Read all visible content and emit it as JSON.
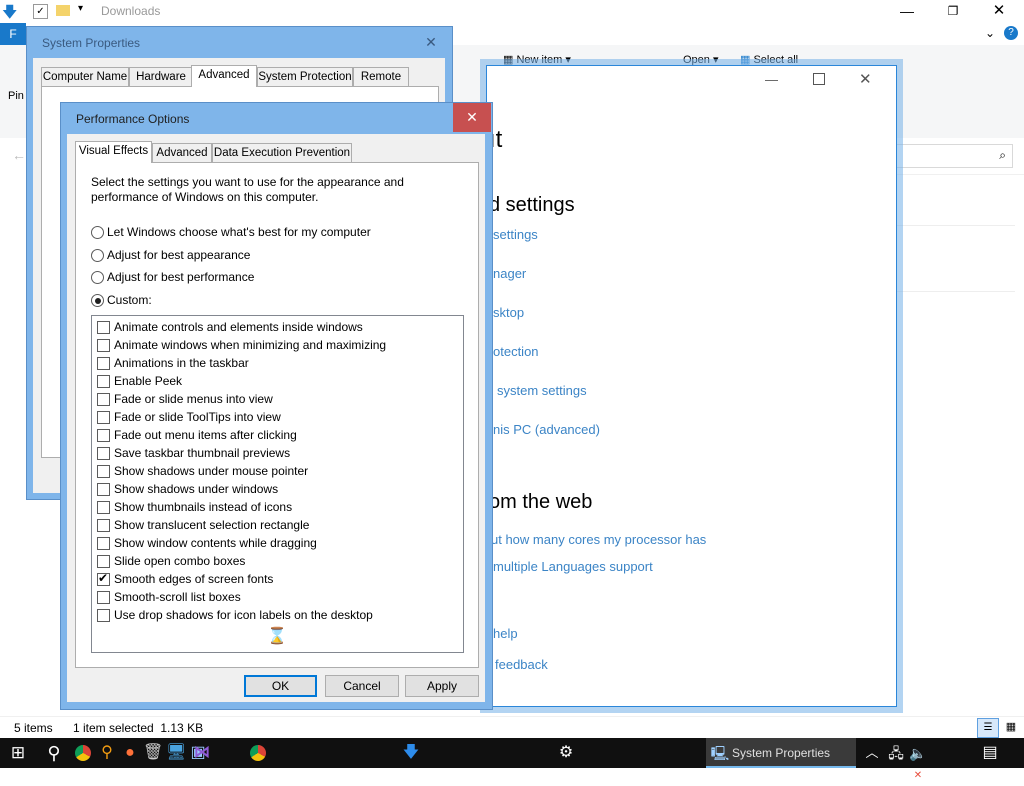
{
  "explorer": {
    "title": "Downloads",
    "file_tab": "F",
    "ribbon_new_item": "New item",
    "ribbon_open": "Open",
    "ribbon_select_all": "Select all",
    "pin_label": "Pin",
    "status_items": "5 items",
    "status_selected": "1 item selected  1.13 KB"
  },
  "about": {
    "heading_partial": "ıt",
    "related_heading": "d settings",
    "links": [
      "settings",
      "nager",
      "sktop",
      "otection",
      "system settings",
      "nis PC (advanced)"
    ],
    "web_heading": "om the web",
    "web_links": [
      "ut how many cores my processor has",
      "multiple Languages support"
    ],
    "help_link": "help",
    "feedback_link": "feedback"
  },
  "system_properties": {
    "title": "System Properties",
    "tabs": [
      "Computer Name",
      "Hardware",
      "Advanced",
      "System Protection",
      "Remote"
    ]
  },
  "performance_options": {
    "title": "Performance Options",
    "tabs": [
      "Visual Effects",
      "Advanced",
      "Data Execution Prevention"
    ],
    "description": "Select the settings you want to use for the appearance and performance of Windows on this computer.",
    "radios": [
      {
        "label": "Let Windows choose what's best for my computer",
        "selected": false
      },
      {
        "label": "Adjust for best appearance",
        "selected": false
      },
      {
        "label": "Adjust for best performance",
        "selected": false
      },
      {
        "label": "Custom:",
        "selected": true
      }
    ],
    "options": [
      {
        "label": "Animate controls and elements inside windows",
        "checked": false
      },
      {
        "label": "Animate windows when minimizing and maximizing",
        "checked": false
      },
      {
        "label": "Animations in the taskbar",
        "checked": false
      },
      {
        "label": "Enable Peek",
        "checked": false
      },
      {
        "label": "Fade or slide menus into view",
        "checked": false
      },
      {
        "label": "Fade or slide ToolTips into view",
        "checked": false
      },
      {
        "label": "Fade out menu items after clicking",
        "checked": false
      },
      {
        "label": "Save taskbar thumbnail previews",
        "checked": false
      },
      {
        "label": "Show shadows under mouse pointer",
        "checked": false
      },
      {
        "label": "Show shadows under windows",
        "checked": false
      },
      {
        "label": "Show thumbnails instead of icons",
        "checked": false
      },
      {
        "label": "Show translucent selection rectangle",
        "checked": false
      },
      {
        "label": "Show window contents while dragging",
        "checked": false
      },
      {
        "label": "Slide open combo boxes",
        "checked": false
      },
      {
        "label": "Smooth edges of screen fonts",
        "checked": true
      },
      {
        "label": "Smooth-scroll list boxes",
        "checked": false
      },
      {
        "label": "Use drop shadows for icon labels on the desktop",
        "checked": false
      }
    ],
    "buttons": {
      "ok": "OK",
      "cancel": "Cancel",
      "apply": "Apply"
    }
  },
  "taskbar": {
    "active_window": "System Properties"
  },
  "colors": {
    "accent": "#0078d7",
    "link": "#3b84c6",
    "dialog_frame": "#7fb5ea",
    "close_red": "#c75050",
    "taskbar": "#101010"
  }
}
